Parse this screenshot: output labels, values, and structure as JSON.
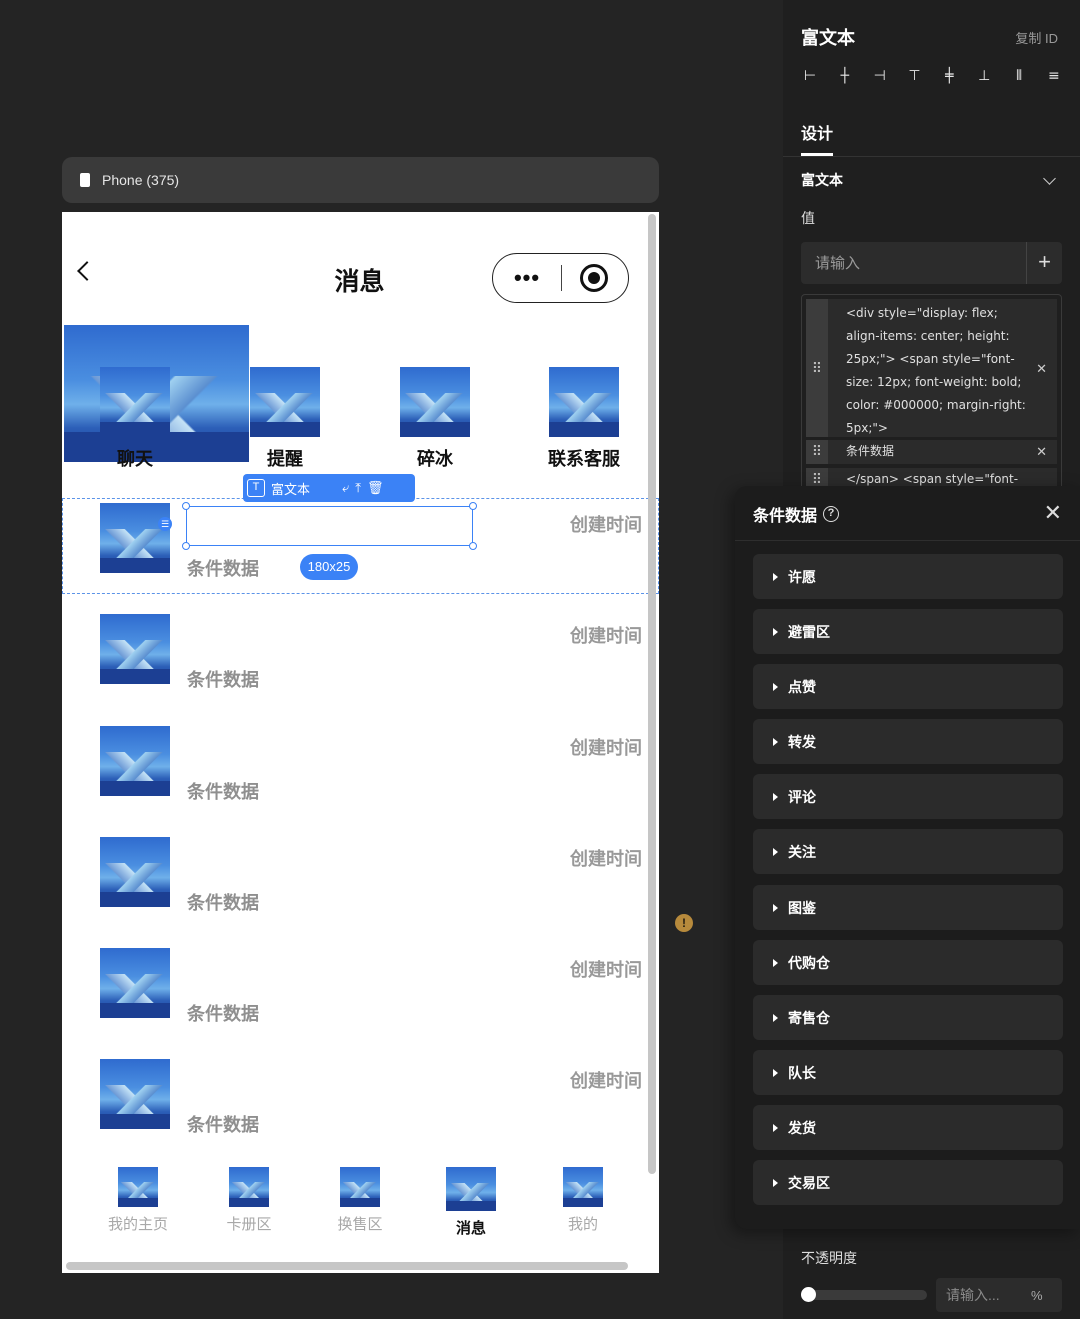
{
  "device": {
    "label": "Phone (375)"
  },
  "phone": {
    "title": "消息",
    "capsule_dots": "•••",
    "categories": [
      {
        "label": "聊天"
      },
      {
        "label": "提醒"
      },
      {
        "label": "碎冰"
      },
      {
        "label": "联系客服"
      }
    ],
    "rows": [
      {
        "cond": "条件数据",
        "time": "创建时间"
      },
      {
        "cond": "条件数据",
        "time": "创建时间"
      },
      {
        "cond": "条件数据",
        "time": "创建时间"
      },
      {
        "cond": "条件数据",
        "time": "创建时间"
      },
      {
        "cond": "条件数据",
        "time": "创建时间"
      },
      {
        "cond": "条件数据",
        "time": "创建时间"
      }
    ],
    "selection_toolbar": {
      "label": "富文本"
    },
    "size_badge": "180x25",
    "tabs": [
      {
        "label": "我的主页",
        "active": false
      },
      {
        "label": "卡册区",
        "active": false
      },
      {
        "label": "换售区",
        "active": false
      },
      {
        "label": "消息",
        "active": true
      },
      {
        "label": "我的",
        "active": false
      }
    ]
  },
  "panel": {
    "title": "富文本",
    "copy_id": "复制 ID",
    "tab_design": "设计",
    "section_title": "富文本",
    "value_label": "值",
    "value_placeholder": "请输入",
    "code_items": [
      "<div style=\"display: flex; align-items: center; height: 25px;\"> <span style=\"font-size: 12px; font-weight: bold; color: #000000; margin-right: 5px;\">",
      "条件数据",
      "</span> <span style=\"font-"
    ],
    "opacity_label": "不透明度",
    "opacity_placeholder": "请输入...",
    "opacity_unit": "%"
  },
  "popover": {
    "title": "条件数据",
    "items": [
      "许愿",
      "避雷区",
      "点赞",
      "转发",
      "评论",
      "关注",
      "图鉴",
      "代购仓",
      "寄售仓",
      "队长",
      "发货",
      "交易区"
    ]
  }
}
